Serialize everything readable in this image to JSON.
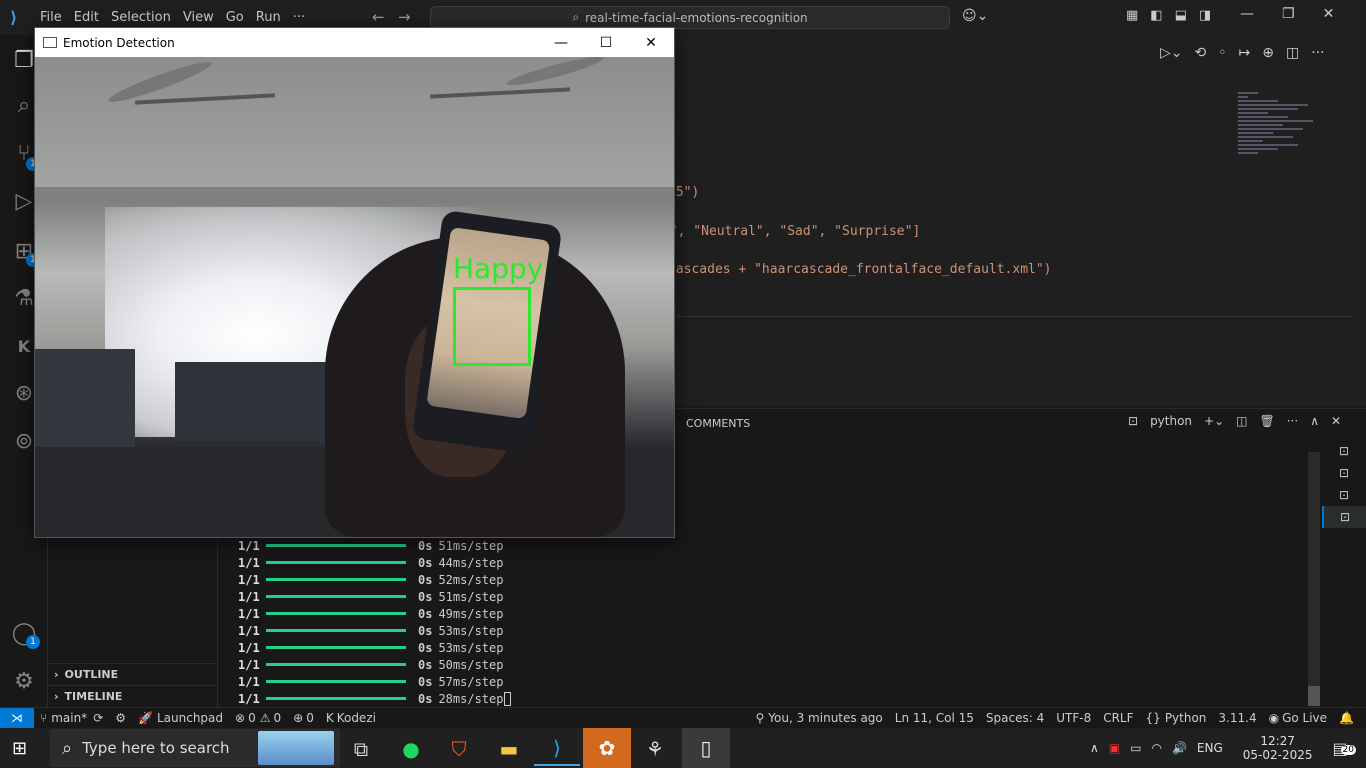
{
  "titlebar": {
    "menu": [
      "File",
      "Edit",
      "Selection",
      "View",
      "Go",
      "Run",
      "···"
    ],
    "command_center": "real-time-facial-emotions-recognition"
  },
  "activity_badges": {
    "source_control": "1",
    "extensions": "1",
    "accounts": "1"
  },
  "sidebar": {
    "outline": "OUTLINE",
    "timeline": "TIMELINE"
  },
  "editor": {
    "lines": [
      {
        "text": "h5\")"
      },
      {
        "text": "y\", \"Neutral\", \"Sad\", \"Surprise\"]"
      },
      {
        "text": "cascades + \"haarcascade_frontalface_default.xml\")"
      }
    ]
  },
  "panel": {
    "comments_tab": "COMMENTS",
    "terminal_name": "python"
  },
  "terminal": {
    "rows": [
      {
        "step": "1/1",
        "time": "0s",
        "rate": "51ms/step"
      },
      {
        "step": "1/1",
        "time": "0s",
        "rate": "44ms/step"
      },
      {
        "step": "1/1",
        "time": "0s",
        "rate": "52ms/step"
      },
      {
        "step": "1/1",
        "time": "0s",
        "rate": "51ms/step"
      },
      {
        "step": "1/1",
        "time": "0s",
        "rate": "49ms/step"
      },
      {
        "step": "1/1",
        "time": "0s",
        "rate": "53ms/step"
      },
      {
        "step": "1/1",
        "time": "0s",
        "rate": "53ms/step"
      },
      {
        "step": "1/1",
        "time": "0s",
        "rate": "50ms/step"
      },
      {
        "step": "1/1",
        "time": "0s",
        "rate": "57ms/step"
      },
      {
        "step": "1/1",
        "time": "0s",
        "rate": "28ms/step"
      }
    ]
  },
  "status": {
    "branch": "main*",
    "launchpad": "Launchpad",
    "errors": "0",
    "warnings": "0",
    "ports": "0",
    "kodezi": "Kodezi",
    "blame": "You, 3 minutes ago",
    "position": "Ln 11, Col 15",
    "spaces": "Spaces: 4",
    "encoding": "UTF-8",
    "eol": "CRLF",
    "language": "Python",
    "version": "3.11.4",
    "golive": "Go Live"
  },
  "popup": {
    "title": "Emotion Detection",
    "emotion_label": "Happy",
    "box_color": "#2ee82e"
  },
  "taskbar": {
    "search_placeholder": "Type here to search",
    "lang": "ENG",
    "time": "12:27",
    "date": "05-02-2025",
    "notifications": "20"
  }
}
